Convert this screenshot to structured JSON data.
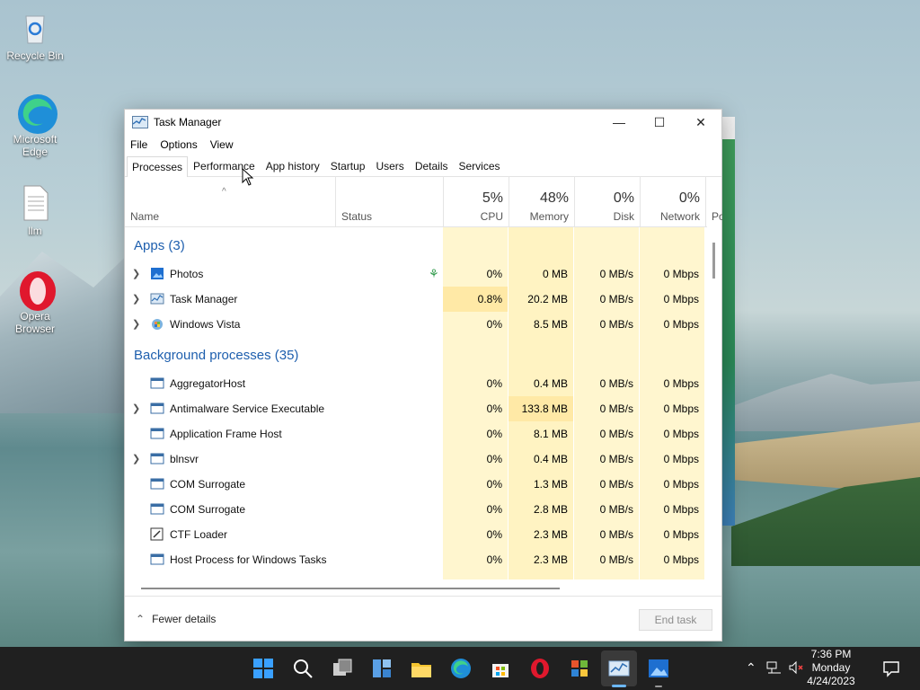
{
  "desktop": {
    "icons": [
      {
        "label": "Recycle Bin"
      },
      {
        "label": "Microsoft Edge"
      },
      {
        "label": "llm"
      },
      {
        "label": "Opera Browser"
      }
    ]
  },
  "window": {
    "title": "Task Manager",
    "controls": {
      "minimize": "—",
      "maximize": "☐",
      "close": "✕"
    },
    "menu": [
      "File",
      "Options",
      "View"
    ],
    "tabs": [
      "Processes",
      "Performance",
      "App history",
      "Startup",
      "Users",
      "Details",
      "Services"
    ],
    "active_tab": "Processes",
    "columns": {
      "name": "Name",
      "status": "Status",
      "cpu": {
        "pct": "5%",
        "label": "CPU"
      },
      "memory": {
        "pct": "48%",
        "label": "Memory"
      },
      "disk": {
        "pct": "0%",
        "label": "Disk"
      },
      "network": {
        "pct": "0%",
        "label": "Network"
      },
      "power": {
        "label": "Po"
      }
    },
    "groups": {
      "apps": "Apps (3)",
      "background": "Background processes (35)"
    },
    "apps": [
      {
        "name": "Photos",
        "cpu": "0%",
        "memory": "0 MB",
        "disk": "0 MB/s",
        "network": "0 Mbps"
      },
      {
        "name": "Task Manager",
        "cpu": "0.8%",
        "memory": "20.2 MB",
        "disk": "0 MB/s",
        "network": "0 Mbps"
      },
      {
        "name": "Windows Vista",
        "cpu": "0%",
        "memory": "8.5 MB",
        "disk": "0 MB/s",
        "network": "0 Mbps"
      }
    ],
    "background": [
      {
        "name": "AggregatorHost",
        "cpu": "0%",
        "memory": "0.4 MB",
        "disk": "0 MB/s",
        "network": "0 Mbps"
      },
      {
        "name": "Antimalware Service Executable",
        "cpu": "0%",
        "memory": "133.8 MB",
        "disk": "0 MB/s",
        "network": "0 Mbps"
      },
      {
        "name": "Application Frame Host",
        "cpu": "0%",
        "memory": "8.1 MB",
        "disk": "0 MB/s",
        "network": "0 Mbps"
      },
      {
        "name": "blnsvr",
        "cpu": "0%",
        "memory": "0.4 MB",
        "disk": "0 MB/s",
        "network": "0 Mbps"
      },
      {
        "name": "COM Surrogate",
        "cpu": "0%",
        "memory": "1.3 MB",
        "disk": "0 MB/s",
        "network": "0 Mbps"
      },
      {
        "name": "COM Surrogate",
        "cpu": "0%",
        "memory": "2.8 MB",
        "disk": "0 MB/s",
        "network": "0 Mbps"
      },
      {
        "name": "CTF Loader",
        "cpu": "0%",
        "memory": "2.3 MB",
        "disk": "0 MB/s",
        "network": "0 Mbps"
      },
      {
        "name": "Host Process for Windows Tasks",
        "cpu": "0%",
        "memory": "2.3 MB",
        "disk": "0 MB/s",
        "network": "0 Mbps"
      }
    ],
    "footer": {
      "fewer_details": "Fewer details",
      "end_task": "End task"
    }
  },
  "taskbar": {
    "clock": {
      "time": "7:36 PM",
      "day": "Monday",
      "date": "4/24/2023"
    }
  },
  "colors": {
    "accent": "#1e5fae",
    "cpu_fill": "#fff4c4",
    "mem_fill": "#fff0b3",
    "light_fill": "#fff8d8"
  }
}
